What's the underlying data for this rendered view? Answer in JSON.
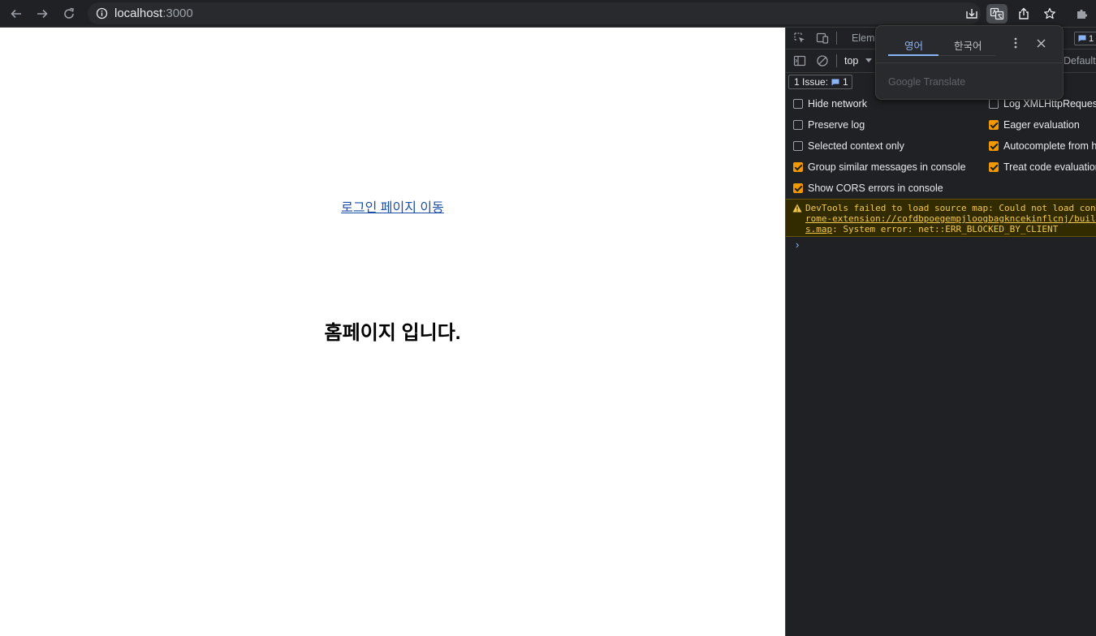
{
  "browser": {
    "url_host": "localhost",
    "url_port": ":3000",
    "toolbar_icons": [
      "back-icon",
      "forward-icon",
      "reload-icon",
      "info-icon",
      "install-icon",
      "translate-icon",
      "share-icon",
      "bookmark-star-icon",
      "extensions-icon"
    ]
  },
  "page": {
    "login_link": "로그인 페이지 이동",
    "heading": "홈페이지 입니다."
  },
  "devtools": {
    "tab_elements": "Eleme",
    "issue_count_top": "1",
    "context": "top",
    "levels": "Default",
    "issues_label": "1 Issue:",
    "issues_count": "1",
    "settings": {
      "left": [
        {
          "label": "Hide network",
          "checked": false
        },
        {
          "label": "Preserve log",
          "checked": false
        },
        {
          "label": "Selected context only",
          "checked": false
        },
        {
          "label": "Group similar messages in console",
          "checked": true
        },
        {
          "label": "Show CORS errors in console",
          "checked": true
        }
      ],
      "right": [
        {
          "label": "Log XMLHttpRequests",
          "checked": false
        },
        {
          "label": "Eager evaluation",
          "checked": true
        },
        {
          "label": "Autocomplete from history",
          "checked": true
        },
        {
          "label": "Treat code evaluation as user action",
          "checked": true
        }
      ]
    },
    "warning": {
      "line1": "DevTools failed to load source map: Could not load content for chrome-extension",
      "line2": "rome-extension://cofdbpoegempjloogbagkncekinflcnj/build/content.js",
      "line3_link": "s.map",
      "line3_rest": ": System error: net::ERR_BLOCKED_BY_CLIENT"
    },
    "prompt": "›",
    "colors": {
      "warning_text": "#f2c94c",
      "checkbox_on": "#f29900",
      "link": "#1a4fa8"
    }
  },
  "translate_popup": {
    "tab_source": "영어",
    "tab_target": "한국어",
    "brand": "Google Translate"
  }
}
